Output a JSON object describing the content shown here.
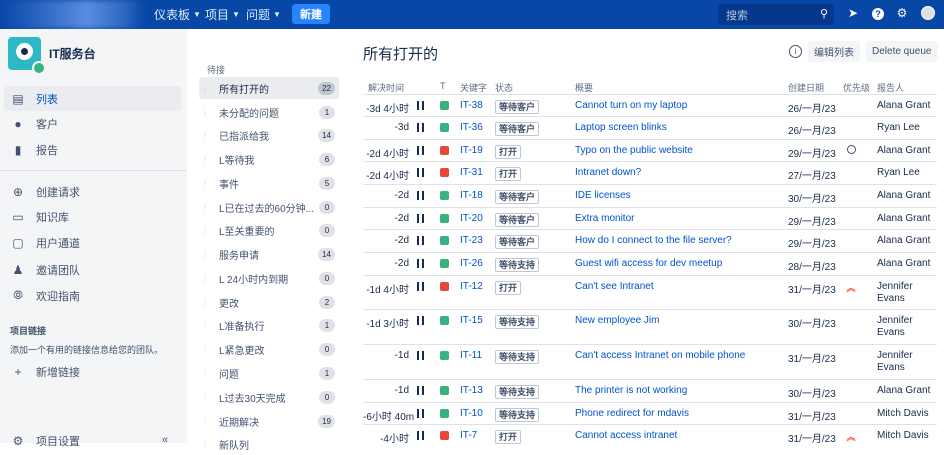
{
  "topbar": {
    "nav": [
      "仪表板",
      "项目",
      "问题"
    ],
    "new_label": "新建",
    "search_placeholder": "搜索"
  },
  "sidebar": {
    "project_name": "IT服务台",
    "items": [
      {
        "label": "列表",
        "icon": "list-icon",
        "active": true
      },
      {
        "label": "客户",
        "icon": "customers-icon"
      },
      {
        "label": "报告",
        "icon": "reports-icon"
      },
      {
        "label": "创建请求",
        "icon": "create-request-icon"
      },
      {
        "label": "知识库",
        "icon": "knowledge-base-icon"
      },
      {
        "label": "用户通道",
        "icon": "portal-icon"
      },
      {
        "label": "邀请团队",
        "icon": "invite-team-icon"
      },
      {
        "label": "欢迎指南",
        "icon": "compass-icon"
      }
    ],
    "links_title": "项目链接",
    "links_desc": "添加一个有用的链接信息给您的团队。",
    "add_link": "新增链接",
    "settings": "项目设置"
  },
  "queues": {
    "heading": "待接",
    "items": [
      {
        "label": "所有打开的",
        "count": "22",
        "active": true
      },
      {
        "label": "未分配的问题",
        "count": "1"
      },
      {
        "label": "已指派给我",
        "count": "14"
      },
      {
        "label": "L等待我",
        "count": "6"
      },
      {
        "label": "事件",
        "count": "5"
      },
      {
        "label": "L已在过去的60分钟...",
        "count": "0"
      },
      {
        "label": "L至关重要的",
        "count": "0"
      },
      {
        "label": "服务申请",
        "count": "14"
      },
      {
        "label": "L 24小时内到期",
        "count": "0"
      },
      {
        "label": "更改",
        "count": "2"
      },
      {
        "label": "L准备执行",
        "count": "1"
      },
      {
        "label": "L紧急更改",
        "count": "0"
      },
      {
        "label": "问题",
        "count": "1"
      },
      {
        "label": "L过去30天完成",
        "count": "0"
      },
      {
        "label": "近期解决",
        "count": "19"
      },
      {
        "label": "新队列",
        "count": ""
      }
    ]
  },
  "main": {
    "title": "所有打开的",
    "edit_columns": "编辑列表",
    "delete_queue": "Delete queue",
    "columns": [
      "解决时间",
      "T",
      "关键字",
      "状态",
      "概要",
      "创建日期",
      "优先级",
      "报告人"
    ],
    "rows": [
      {
        "time": "-3d 4小时",
        "type": "g",
        "key": "IT-38",
        "status": "等待客户",
        "summary": "Cannot turn on my laptop",
        "created": "26/一月/23",
        "priority": "",
        "reporter": "Alana Grant"
      },
      {
        "time": "-3d",
        "type": "g",
        "key": "IT-36",
        "status": "等待客户",
        "summary": "Laptop screen blinks",
        "created": "26/一月/23",
        "priority": "",
        "reporter": "Ryan Lee"
      },
      {
        "time": "-2d 4小时",
        "type": "r",
        "key": "IT-19",
        "status": "打开",
        "summary": "Typo on the public website",
        "created": "29/一月/23",
        "priority": "low",
        "reporter": "Alana Grant"
      },
      {
        "time": "-2d 4小时",
        "type": "r",
        "key": "IT-31",
        "status": "打开",
        "summary": "Intranet down?",
        "created": "27/一月/23",
        "priority": "",
        "reporter": "Ryan Lee"
      },
      {
        "time": "-2d",
        "type": "g",
        "key": "IT-18",
        "status": "等待客户",
        "summary": "IDE licenses",
        "created": "30/一月/23",
        "priority": "",
        "reporter": "Alana Grant"
      },
      {
        "time": "-2d",
        "type": "g",
        "key": "IT-20",
        "status": "等待客户",
        "summary": "Extra monitor",
        "created": "29/一月/23",
        "priority": "",
        "reporter": "Alana Grant"
      },
      {
        "time": "-2d",
        "type": "g",
        "key": "IT-23",
        "status": "等待客户",
        "summary": "How do I connect to the file server?",
        "created": "29/一月/23",
        "priority": "",
        "reporter": "Alana Grant"
      },
      {
        "time": "-2d",
        "type": "g",
        "key": "IT-26",
        "status": "等待支持",
        "summary": "Guest wifi access for dev meetup",
        "created": "28/一月/23",
        "priority": "",
        "reporter": "Alana Grant"
      },
      {
        "time": "-1d 4小时",
        "type": "r",
        "key": "IT-12",
        "status": "打开",
        "summary": "Can't see Intranet",
        "created": "31/一月/23",
        "priority": "high",
        "reporter": "Jennifer Evans"
      },
      {
        "time": "-1d 3小时",
        "type": "g",
        "key": "IT-15",
        "status": "等待支持",
        "summary": "New employee Jim",
        "created": "30/一月/23",
        "priority": "",
        "reporter": "Jennifer Evans"
      },
      {
        "time": "-1d",
        "type": "g",
        "key": "IT-11",
        "status": "等待支持",
        "summary": "Can't access Intranet on mobile phone",
        "created": "31/一月/23",
        "priority": "",
        "reporter": "Jennifer Evans"
      },
      {
        "time": "-1d",
        "type": "g",
        "key": "IT-13",
        "status": "等待支持",
        "summary": "The printer is not working",
        "created": "30/一月/23",
        "priority": "",
        "reporter": "Alana Grant"
      },
      {
        "time": "-6小时 40m",
        "type": "g",
        "key": "IT-10",
        "status": "等待支持",
        "summary": "Phone redirect for mdavis",
        "created": "31/一月/23",
        "priority": "",
        "reporter": "Mitch Davis"
      },
      {
        "time": "-4小时",
        "type": "r",
        "key": "IT-7",
        "status": "打开",
        "summary": "Cannot access intranet",
        "created": "31/一月/23",
        "priority": "high",
        "reporter": "Mitch Davis"
      }
    ]
  }
}
